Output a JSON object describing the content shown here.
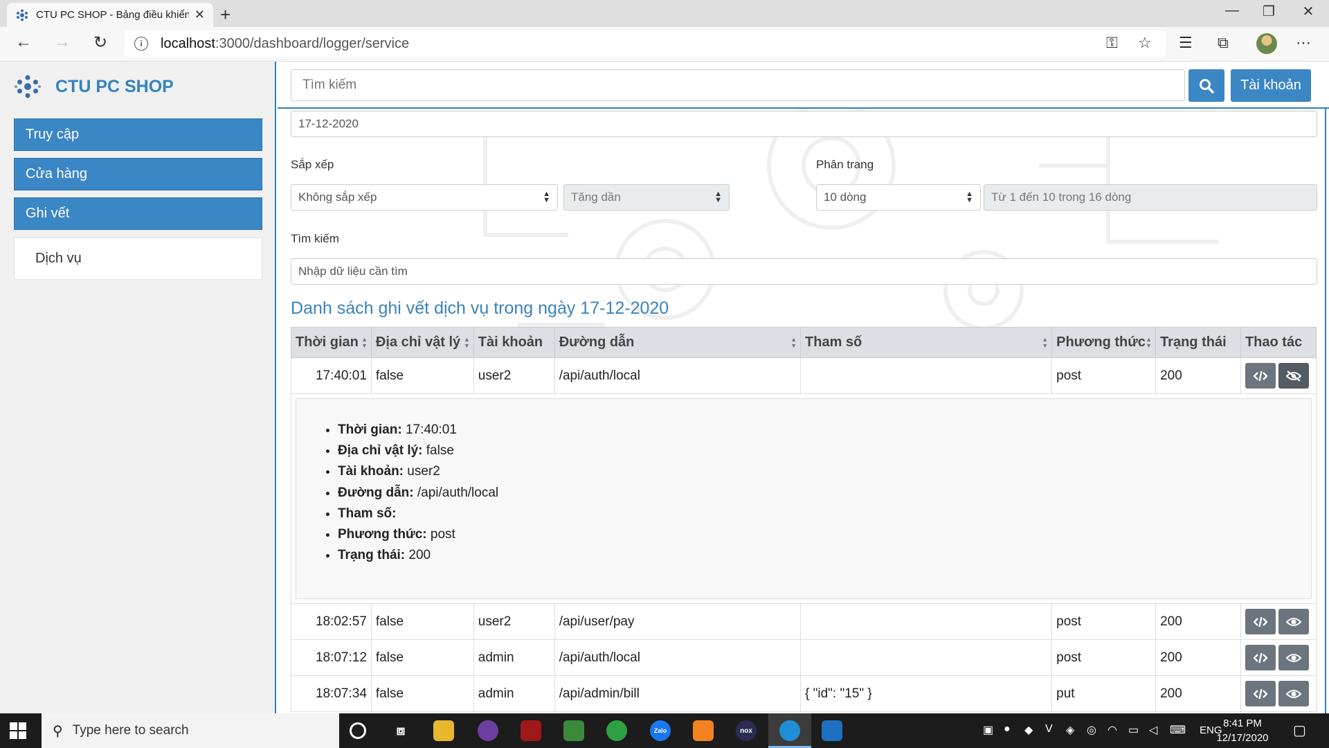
{
  "browser": {
    "tab_title": "CTU PC SHOP - Bảng điều khiển",
    "url_host": "localhost",
    "url_path": ":3000/dashboard/logger/service"
  },
  "app": {
    "brand": "CTU PC SHOP",
    "search_placeholder": "Tìm kiếm",
    "account_label": "Tài khoản"
  },
  "sidebar": {
    "items": [
      {
        "label": "Truy cập"
      },
      {
        "label": "Cửa hàng"
      },
      {
        "label": "Ghi vết"
      }
    ],
    "sub_item": "Dịch vụ"
  },
  "filters": {
    "date_value": "17-12-2020",
    "sort_label": "Sắp xếp",
    "sort_value": "Không sắp xếp",
    "order_value": "Tăng dần",
    "paging_label": "Phân trang",
    "paging_value": "10 dòng",
    "paging_info": "Từ 1 đến 10 trong 16 dòng",
    "search_label": "Tìm kiếm",
    "search_placeholder": "Nhập dữ liệu cần tìm"
  },
  "list": {
    "title": "Danh sách ghi vết dịch vụ trong ngày 17-12-2020",
    "columns": [
      "Thời gian",
      "Địa chỉ vật lý",
      "Tài khoản",
      "Đường dẫn",
      "Tham số",
      "Phương thức",
      "Trạng thái",
      "Thao tác"
    ],
    "rows": [
      {
        "time": "17:40:01",
        "mac": "false",
        "account": "user2",
        "path": "/api/auth/local",
        "params": "",
        "method": "post",
        "status": "200"
      },
      {
        "time": "18:02:57",
        "mac": "false",
        "account": "user2",
        "path": "/api/user/pay",
        "params": "",
        "method": "post",
        "status": "200"
      },
      {
        "time": "18:07:12",
        "mac": "false",
        "account": "admin",
        "path": "/api/auth/local",
        "params": "",
        "method": "post",
        "status": "200"
      },
      {
        "time": "18:07:34",
        "mac": "false",
        "account": "admin",
        "path": "/api/admin/bill",
        "params": "{ \"id\": \"15\" }",
        "method": "put",
        "status": "200"
      }
    ],
    "detail": {
      "time_label": "Thời gian:",
      "time_value": "17:40:01",
      "mac_label": "Địa chỉ vật lý:",
      "mac_value": "false",
      "account_label": "Tài khoản:",
      "account_value": "user2",
      "path_label": "Đường dẫn:",
      "path_value": "/api/auth/local",
      "params_label": "Tham số:",
      "params_value": "",
      "method_label": "Phương thức:",
      "method_value": "post",
      "status_label": "Trạng thái:",
      "status_value": "200"
    }
  },
  "taskbar": {
    "search_text": "Type here to search",
    "lang": "ENG",
    "time": "8:41 PM",
    "date": "12/17/2020"
  },
  "colors": {
    "primary": "#3b86c4",
    "brand_text": "#3283c0",
    "action_button": "#6c757d"
  }
}
